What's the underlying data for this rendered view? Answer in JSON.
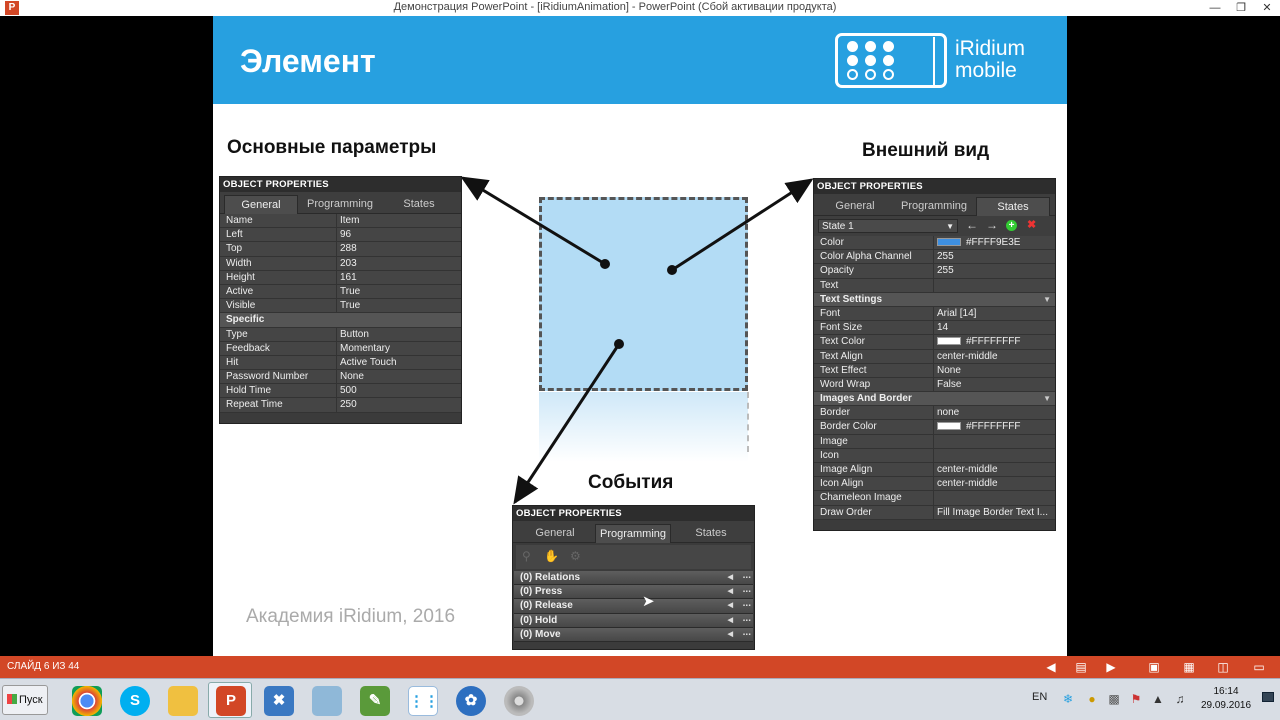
{
  "window": {
    "title": "Демонстрация PowerPoint - [iRidiumAnimation] - PowerPoint (Сбой активации продукта)",
    "app_icon": "P"
  },
  "slide": {
    "title": "Элемент",
    "logo": {
      "line1": "iRidium",
      "line2": "mobile"
    },
    "heading_general": "Основные параметры",
    "heading_appearance": "Внешний вид",
    "heading_events": "События",
    "watermark": "Академия iRidium, 2016"
  },
  "general_panel": {
    "header": "OBJECT PROPERTIES",
    "tabs": [
      "General",
      "Programming",
      "States"
    ],
    "active_tab": "General",
    "rows": [
      {
        "k": "Name",
        "v": "Item"
      },
      {
        "k": "Left",
        "v": "96"
      },
      {
        "k": "Top",
        "v": "288"
      },
      {
        "k": "Width",
        "v": "203"
      },
      {
        "k": "Height",
        "v": "161"
      },
      {
        "k": "Active",
        "v": "True"
      },
      {
        "k": "Visible",
        "v": "True"
      },
      {
        "k": "Specific",
        "v": ""
      },
      {
        "k": "Type",
        "v": "Button"
      },
      {
        "k": "Feedback",
        "v": "Momentary"
      },
      {
        "k": "Hit",
        "v": "Active Touch"
      },
      {
        "k": "Password Number",
        "v": "None"
      },
      {
        "k": "Hold Time",
        "v": "500"
      },
      {
        "k": "Repeat Time",
        "v": "250"
      }
    ]
  },
  "states_panel": {
    "header": "OBJECT PROPERTIES",
    "tabs": [
      "General",
      "Programming",
      "States"
    ],
    "active_tab": "States",
    "state_select": "State 1",
    "rows": [
      {
        "k": "Color",
        "v": "#FFFF9E3E"
      },
      {
        "k": "Color Alpha Channel",
        "v": "255"
      },
      {
        "k": "Opacity",
        "v": "255"
      },
      {
        "k": "Text",
        "v": ""
      },
      {
        "k": "Text Settings",
        "v": ""
      },
      {
        "k": "Font",
        "v": "Arial [14]"
      },
      {
        "k": "Font Size",
        "v": "14"
      },
      {
        "k": "Text Color",
        "v": "#FFFFFFFF"
      },
      {
        "k": "Text Align",
        "v": "center-middle"
      },
      {
        "k": "Text Effect",
        "v": "None"
      },
      {
        "k": "Word Wrap",
        "v": "False"
      },
      {
        "k": "Images And Border",
        "v": ""
      },
      {
        "k": "Border",
        "v": "none"
      },
      {
        "k": "Border Color",
        "v": "#FFFFFFFF"
      },
      {
        "k": "Image",
        "v": ""
      },
      {
        "k": "Icon",
        "v": ""
      },
      {
        "k": "Image Align",
        "v": "center-middle"
      },
      {
        "k": "Icon Align",
        "v": "center-middle"
      },
      {
        "k": "Chameleon Image",
        "v": ""
      },
      {
        "k": "Draw Order",
        "v": "Fill Image Border Text I..."
      }
    ],
    "swatches": {
      "color": "#3e8fe0",
      "text_color": "#ffffff",
      "border_color": "#ffffff"
    }
  },
  "events_panel": {
    "header": "OBJECT PROPERTIES",
    "tabs": [
      "General",
      "Programming",
      "States"
    ],
    "active_tab": "Programming",
    "events": [
      "(0) Relations",
      "(0) Press",
      "(0) Release",
      "(0) Hold",
      "(0) Move"
    ],
    "more": "..."
  },
  "statusbar": {
    "slide_num": "СЛАЙД 6 ИЗ 44"
  },
  "taskbar": {
    "start": "Пуск",
    "lang": "EN",
    "time": "16:14",
    "date": "29.09.2016"
  },
  "colors": {
    "slide_header": "#27a0e0",
    "status_bar": "#d24726",
    "item_fill": "#b3dcf5"
  }
}
